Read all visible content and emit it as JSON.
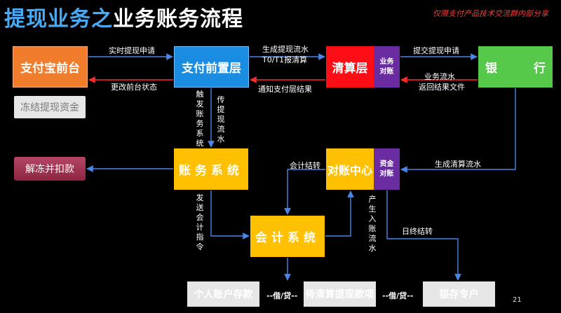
{
  "header": {
    "title_part1": "提现业务之",
    "title_part2": "业务账务流程",
    "subtitle": "仅限支付产品技术交流群内部分享"
  },
  "boxes": {
    "alipay_front": "支付宝前台",
    "payment_front_layer": "支付前置层",
    "clearing_layer": "清算层",
    "clearing_side": "业务对账",
    "bank_left": "银",
    "bank_right": "行",
    "freeze_funds": "冻结提现资金",
    "unfreeze_deduct": "解冻并扣款",
    "account_system": "账务系统",
    "recon_center": "对账中心",
    "recon_side": "资金对账",
    "ledger_system": "会计系统",
    "personal_deposit": "个人账户存款",
    "pending_withdraw": "待清算提现款项",
    "bank_deposit": "银存专户"
  },
  "flows": {
    "realtime_request": "实时提现申请",
    "change_front_status": "更改前台状态",
    "gen_flow": "生成提现流水",
    "t0_t1": "T0/T1报清算",
    "notify_result": "通知支付层结果",
    "submit_request": "提交提现申请",
    "biz_flow": "业务流水",
    "return_file": "返回结果文件",
    "trigger_account": "触发账务系统",
    "send_flow": "传提现流水",
    "gen_clear_flow": "生成清算流水",
    "accounting_transfer": "会计结转",
    "send_accounting": "发送会计指令",
    "gen_entry_flow": "产生入账流水",
    "eod_transfer": "日终结转",
    "debit_credit_1": "--借/贷--",
    "debit_credit_2": "--借/贷--"
  },
  "footer": {
    "page_number": "21"
  },
  "colors": {
    "arrow_blue": "#2e6fd0",
    "arrow_red": "#e82020",
    "orange": "#f07c2c",
    "blue": "#1a8de3",
    "red": "#ff0d17",
    "purple": "#6a2ca0",
    "green": "#57c94a",
    "yellow": "#ffc000"
  }
}
